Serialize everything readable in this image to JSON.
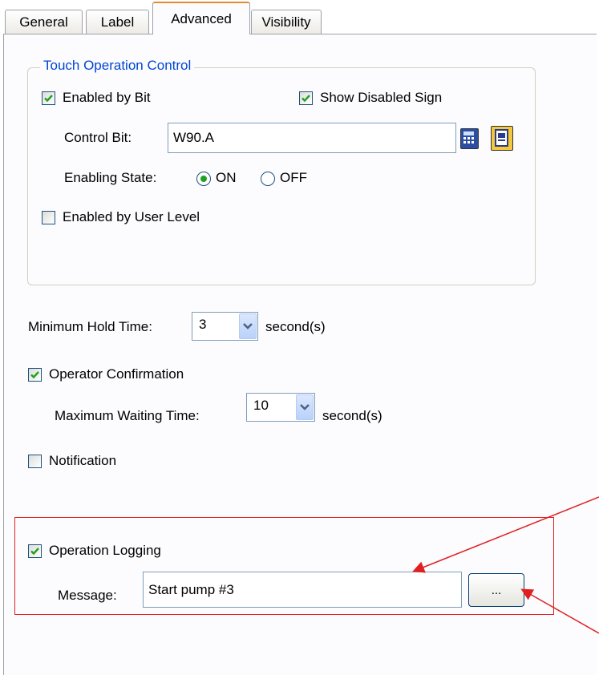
{
  "tabs": [
    {
      "label": "General",
      "active": false
    },
    {
      "label": "Label",
      "active": false
    },
    {
      "label": "Advanced",
      "active": true
    },
    {
      "label": "Visibility",
      "active": false
    }
  ],
  "touch_group": {
    "title": "Touch Operation Control",
    "enabled_by_bit": {
      "label": "Enabled by Bit",
      "checked": true
    },
    "show_disabled_sign": {
      "label": "Show Disabled Sign",
      "checked": true
    },
    "control_bit": {
      "label": "Control Bit:",
      "value": "W90.A"
    },
    "enabling_state": {
      "label": "Enabling State:",
      "on_label": "ON",
      "off_label": "OFF",
      "selected": "ON"
    },
    "enabled_by_user_level": {
      "label": "Enabled by User Level",
      "checked": false
    }
  },
  "min_hold": {
    "label": "Minimum Hold Time:",
    "value": "3",
    "unit": "second(s)"
  },
  "operator_confirmation": {
    "label": "Operator Confirmation",
    "checked": true,
    "max_wait": {
      "label": "Maximum Waiting Time:",
      "value": "10",
      "unit": "second(s)"
    }
  },
  "notification": {
    "label": "Notification",
    "checked": false
  },
  "operation_logging": {
    "label": "Operation Logging",
    "checked": true,
    "message_label": "Message:",
    "message_value": "Start pump #3",
    "browse_label": "..."
  },
  "colors": {
    "accent": "#0046d5",
    "check": "#21a121",
    "annotation": "#e02020"
  }
}
